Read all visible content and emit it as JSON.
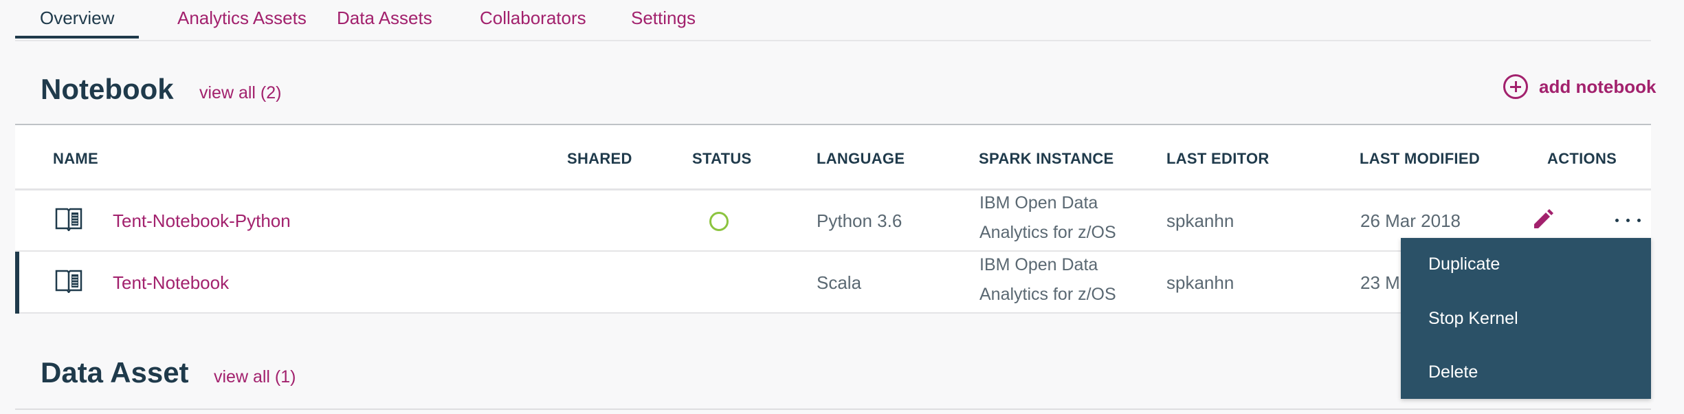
{
  "tabs": [
    {
      "label": "Overview",
      "active": true
    },
    {
      "label": "Analytics Assets"
    },
    {
      "label": "Data Assets"
    },
    {
      "label": "Collaborators"
    },
    {
      "label": "Settings"
    }
  ],
  "notebook_section": {
    "title": "Notebook",
    "view_all": "view all (2)",
    "add_label": "add notebook",
    "add_icon": "plus-circle-icon"
  },
  "table": {
    "columns": [
      "NAME",
      "SHARED",
      "STATUS",
      "LANGUAGE",
      "SPARK INSTANCE",
      "LAST EDITOR",
      "LAST MODIFIED",
      "ACTIONS"
    ],
    "rows": [
      {
        "icon": "notebook-icon",
        "name": "Tent-Notebook-Python",
        "shared": "",
        "status": "status-circle-icon",
        "language": "Python 3.6",
        "spark_line1": "IBM Open Data",
        "spark_line2": "Analytics for z/OS",
        "last_editor": "spkanhn",
        "last_modified": "26 Mar 2018"
      },
      {
        "icon": "notebook-icon",
        "name": "Tent-Notebook",
        "shared": "",
        "language": "Scala",
        "spark_line1": "IBM Open Data",
        "spark_line2": "Analytics for z/OS",
        "last_editor": "spkanhn",
        "last_modified": "23 M"
      }
    ]
  },
  "actions_menu": {
    "items": [
      "Duplicate",
      "Stop Kernel",
      "Delete"
    ]
  },
  "data_asset_section": {
    "title": "Data Asset",
    "view_all": "view all (1)"
  },
  "colors": {
    "accent": "#a2216d",
    "heading": "#1f3a4b",
    "status_ok": "#8cc43f",
    "menu_bg": "#2b5167"
  }
}
